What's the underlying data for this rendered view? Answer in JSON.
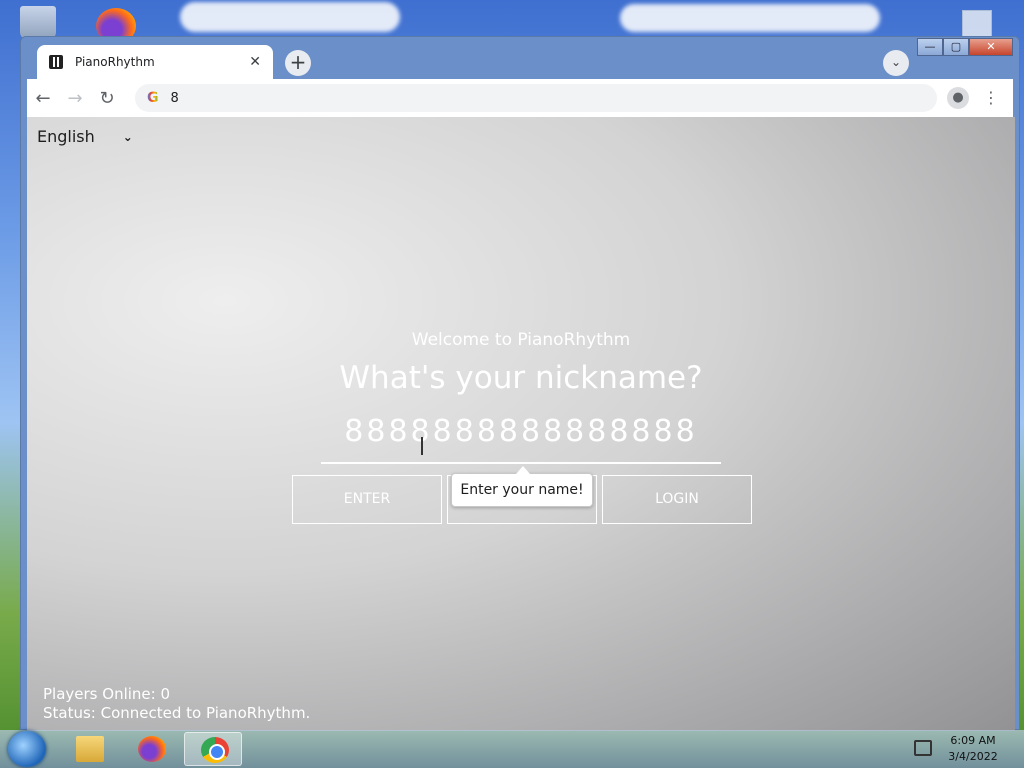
{
  "browser": {
    "tab_title": "PianoRhythm",
    "tab_close": "✕",
    "new_tab": "+",
    "address": "8",
    "window_controls": {
      "minimize": "—",
      "maximize": "▢",
      "close": "✕"
    }
  },
  "page": {
    "language": "English",
    "welcome": "Welcome to PianoRhythm",
    "question": "What's your nickname?",
    "nickname_value": "8888888888888888",
    "buttons": {
      "enter": "ENTER",
      "middle": "",
      "login": "LOGIN"
    },
    "tooltip": "Enter your name!",
    "footer": {
      "players_online": "Players Online: 0",
      "status": "Status: Connected to PianoRhythm."
    }
  },
  "taskbar": {
    "time": "6:09 AM",
    "date": "3/4/2022",
    "apps": [
      "windows-explorer",
      "firefox",
      "chrome"
    ]
  },
  "colors": {
    "accent_white": "#ffffff",
    "chrome_tab": "#ffffff",
    "taskbar": "#7891af"
  }
}
